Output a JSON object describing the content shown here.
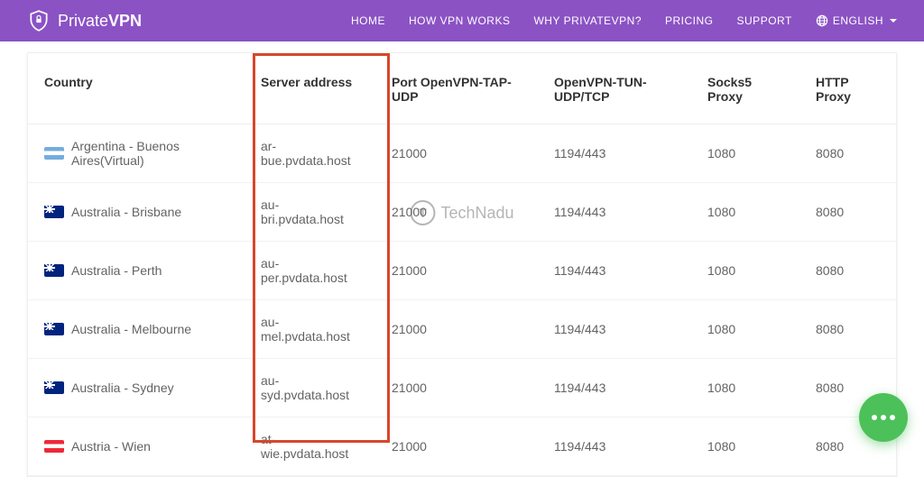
{
  "brand": {
    "name_prefix": "Private",
    "name_suffix": "VPN"
  },
  "nav": {
    "home": "HOME",
    "how": "HOW VPN WORKS",
    "why": "WHY PRIVATEVPN?",
    "pricing": "PRICING",
    "support": "SUPPORT",
    "language": "ENGLISH"
  },
  "headers": {
    "country": "Country",
    "server": "Server address",
    "tap": "Port OpenVPN-TAP-UDP",
    "tun": "OpenVPN-TUN-UDP/TCP",
    "socks": "Socks5 Proxy",
    "http": "HTTP Proxy"
  },
  "rows": [
    {
      "flag": "arg",
      "country": "Argentina - Buenos Aires(Virtual)",
      "server": "ar-bue.pvdata.host",
      "tap": "21000",
      "tun": "1194/443",
      "socks": "1080",
      "http": "8080"
    },
    {
      "flag": "aus",
      "country": "Australia - Brisbane",
      "server": "au-bri.pvdata.host",
      "tap": "21000",
      "tun": "1194/443",
      "socks": "1080",
      "http": "8080"
    },
    {
      "flag": "aus",
      "country": "Australia - Perth",
      "server": "au-per.pvdata.host",
      "tap": "21000",
      "tun": "1194/443",
      "socks": "1080",
      "http": "8080"
    },
    {
      "flag": "aus",
      "country": "Australia - Melbourne",
      "server": "au-mel.pvdata.host",
      "tap": "21000",
      "tun": "1194/443",
      "socks": "1080",
      "http": "8080"
    },
    {
      "flag": "aus",
      "country": "Australia - Sydney",
      "server": "au-syd.pvdata.host",
      "tap": "21000",
      "tun": "1194/443",
      "socks": "1080",
      "http": "8080"
    },
    {
      "flag": "aut",
      "country": "Austria - Wien",
      "server": "at-wie.pvdata.host",
      "tap": "21000",
      "tun": "1194/443",
      "socks": "1080",
      "http": "8080"
    }
  ],
  "watermark": "TechNadu"
}
